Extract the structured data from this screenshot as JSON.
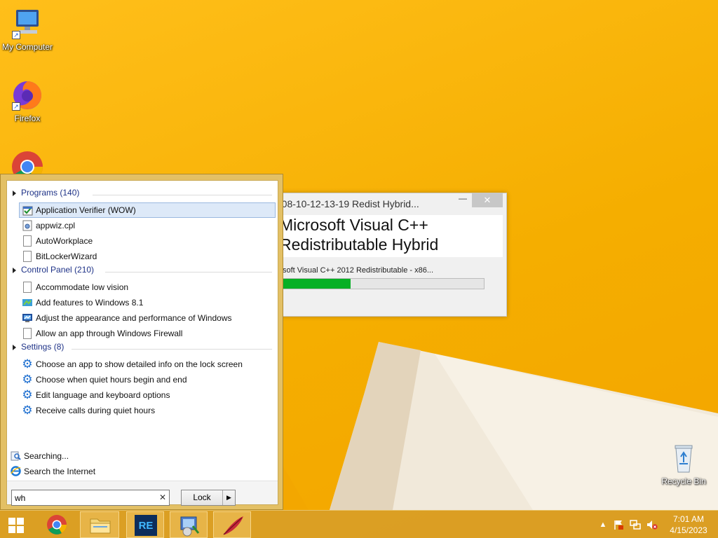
{
  "desktop": {
    "icons": [
      {
        "label": "My Computer",
        "icon": "computer-icon"
      },
      {
        "label": "Firefox",
        "icon": "firefox-icon"
      },
      {
        "label": "",
        "icon": "chrome-icon"
      },
      {
        "label": "Recycle Bin",
        "icon": "recycle-bin-icon"
      }
    ]
  },
  "installer": {
    "title": "-08-10-12-13-19 Redist Hybrid...",
    "minimize_glyph": "—",
    "close_glyph": "✕",
    "headline_line1": "Microsoft Visual C++",
    "headline_line2": "Redistributable Hybrid",
    "status": "soft Visual C++ 2012 Redistributable - x86...",
    "progress": 0.34
  },
  "start_menu": {
    "groups": [
      {
        "header": "Programs (140)",
        "items": [
          {
            "label": "Application Verifier (WOW)",
            "icon": "app-verifier-icon",
            "selected": true
          },
          {
            "label": "appwiz.cpl",
            "icon": "cpl-file-icon"
          },
          {
            "label": "AutoWorkplace",
            "icon": "document-icon"
          },
          {
            "label": "BitLockerWizard",
            "icon": "document-icon"
          }
        ]
      },
      {
        "header": "Control Panel (210)",
        "items": [
          {
            "label": "Accommodate low vision",
            "icon": "document-icon"
          },
          {
            "label": "Add features to Windows 8.1",
            "icon": "add-features-icon"
          },
          {
            "label": "Adjust the appearance and performance of Windows",
            "icon": "performance-icon"
          },
          {
            "label": "Allow an app through Windows Firewall",
            "icon": "document-icon"
          }
        ]
      },
      {
        "header": "Settings (8)",
        "items": [
          {
            "label": "Choose an app to show detailed info on the lock screen",
            "icon": "gear-icon"
          },
          {
            "label": "Choose when quiet hours begin and end",
            "icon": "gear-icon"
          },
          {
            "label": "Edit language and keyboard options",
            "icon": "gear-icon"
          },
          {
            "label": "Receive calls during quiet hours",
            "icon": "gear-icon"
          }
        ]
      }
    ],
    "footer": {
      "searching": "Searching...",
      "search_internet": "Search the Internet"
    },
    "search": {
      "value": "wh",
      "clear_glyph": "✕"
    },
    "power_button": {
      "label": "Lock",
      "arrow": "▶"
    }
  },
  "taskbar": {
    "items": [
      {
        "name": "start-button",
        "icon": "windows-logo-icon"
      },
      {
        "name": "chrome",
        "icon": "chrome-icon"
      },
      {
        "name": "file-explorer",
        "icon": "folder-icon"
      },
      {
        "name": "re-pack",
        "icon": "repack-icon",
        "text": "RE"
      },
      {
        "name": "installer",
        "icon": "installer-icon"
      },
      {
        "name": "feather-app",
        "icon": "feather-icon"
      }
    ],
    "clock": {
      "time": "7:01 AM",
      "date": "4/15/2023"
    }
  },
  "colors": {
    "wallpaper": "#f5ae00",
    "progress_fill": "#06b025",
    "group_header": "#1e3287",
    "selection": "#dde9f8"
  }
}
